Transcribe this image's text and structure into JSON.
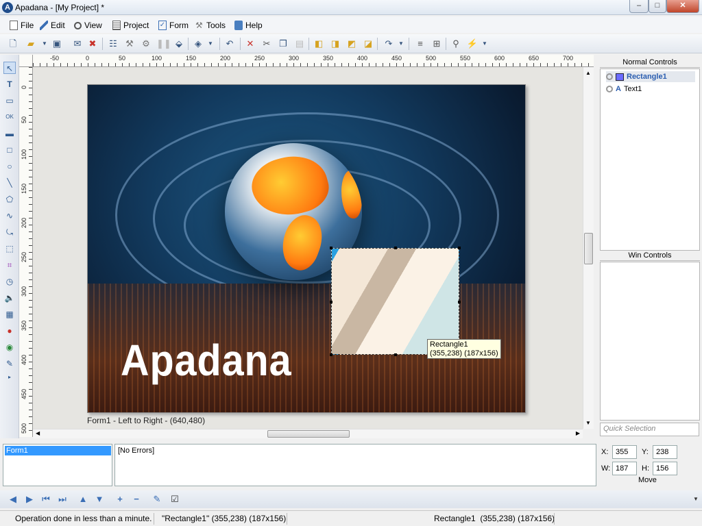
{
  "window": {
    "app_icon": "A",
    "title": "Apadana - [My Project] *",
    "controls": {
      "minimize": "–",
      "maximize": "□",
      "close": "✕"
    }
  },
  "menu": [
    {
      "label": "File",
      "icon": "document-icon"
    },
    {
      "label": "Edit",
      "icon": "pencil-icon"
    },
    {
      "label": "View",
      "icon": "magnifier-icon"
    },
    {
      "label": "Project",
      "icon": "list-icon"
    },
    {
      "label": "Form",
      "icon": "checkbox-icon"
    },
    {
      "label": "Tools",
      "icon": "hammer-icon"
    },
    {
      "label": "Help",
      "icon": "book-icon"
    }
  ],
  "rulers": {
    "horizontal": [
      "-50",
      "0",
      "50",
      "100",
      "150",
      "200",
      "250",
      "300",
      "350",
      "400",
      "450",
      "500",
      "550",
      "600",
      "650",
      "700"
    ],
    "vertical": [
      "0",
      "50",
      "100",
      "150",
      "200",
      "250",
      "300",
      "350",
      "400",
      "450",
      "500"
    ]
  },
  "design": {
    "brand_text": "Apadana",
    "form_caption": "Form1 - Left to Right - (640,480)",
    "tooltip_line1": "Rectangle1",
    "tooltip_line2": "(355,238) (187x156)"
  },
  "panels": {
    "normal_controls_title": "Normal Controls",
    "normal_controls": [
      {
        "name": "Rectangle1",
        "selected": true,
        "icon": "rectangle-icon"
      },
      {
        "name": "Text1",
        "selected": false,
        "icon": "text-icon"
      }
    ],
    "win_controls_title": "Win Controls",
    "quick_selection_placeholder": "Quick Selection"
  },
  "bottom": {
    "form_list": [
      "Form1"
    ],
    "errors": "[No Errors]",
    "x_label": "X:",
    "x_value": "355",
    "y_label": "Y:",
    "y_value": "238",
    "w_label": "W:",
    "w_value": "187",
    "h_label": "H:",
    "h_value": "156",
    "move_label": "Move"
  },
  "status": {
    "message": "Operation done in less than a minute.",
    "selection": "\"Rectangle1\" (355,238) (187x156)",
    "object_info": "Rectangle1  (355,238) (187x156)"
  },
  "colors": {
    "selection_highlight": "#3399ff",
    "selected_tree_text": "#2a5db0"
  }
}
